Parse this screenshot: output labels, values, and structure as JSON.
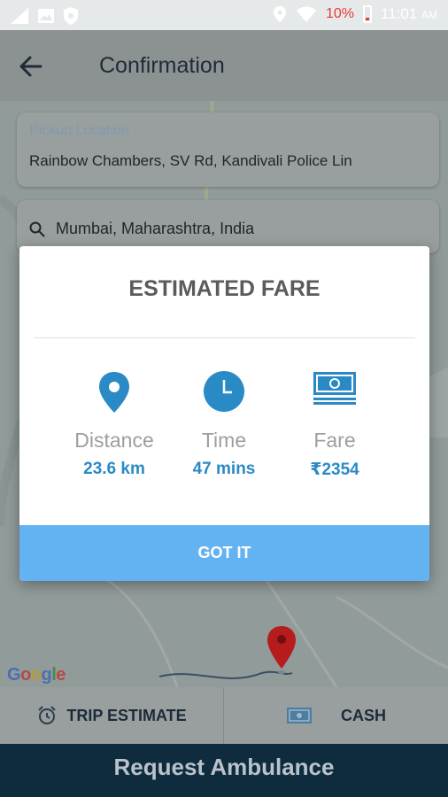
{
  "status_bar": {
    "battery_percent": "10%",
    "time": "11:01",
    "ampm": "AM",
    "icons": [
      "signal-icon",
      "image-icon",
      "vpn-shield-icon",
      "location-icon",
      "wifi-icon",
      "battery-icon"
    ]
  },
  "header": {
    "title": "Confirmation",
    "back_icon": "arrow-left-icon"
  },
  "pickup": {
    "label": "Pickup Location",
    "value": "Rainbow Chambers, SV Rd, Kandivali Police Lin"
  },
  "dropoff": {
    "value": "Mumbai, Maharashtra, India"
  },
  "map": {
    "attribution": [
      "G",
      "o",
      "o",
      "g",
      "l",
      "e"
    ]
  },
  "modal": {
    "title": "ESTIMATED FARE",
    "items": [
      {
        "key": "Distance",
        "value": "23.6 km",
        "icon": "location-pin-icon"
      },
      {
        "key": "Time",
        "value": "47 mins",
        "icon": "clock-icon"
      },
      {
        "key": "Fare",
        "value": "₹2354",
        "icon": "banknote-icon"
      }
    ],
    "button": "GOT IT"
  },
  "bottom": {
    "trip_estimate": "TRIP ESTIMATE",
    "payment": "CASH",
    "request": "Request Ambulance"
  },
  "colors": {
    "accent": "#2a8ac6",
    "button": "#63b3f3",
    "request_bar": "#0f2c3f",
    "pin": "#b71c1c"
  }
}
